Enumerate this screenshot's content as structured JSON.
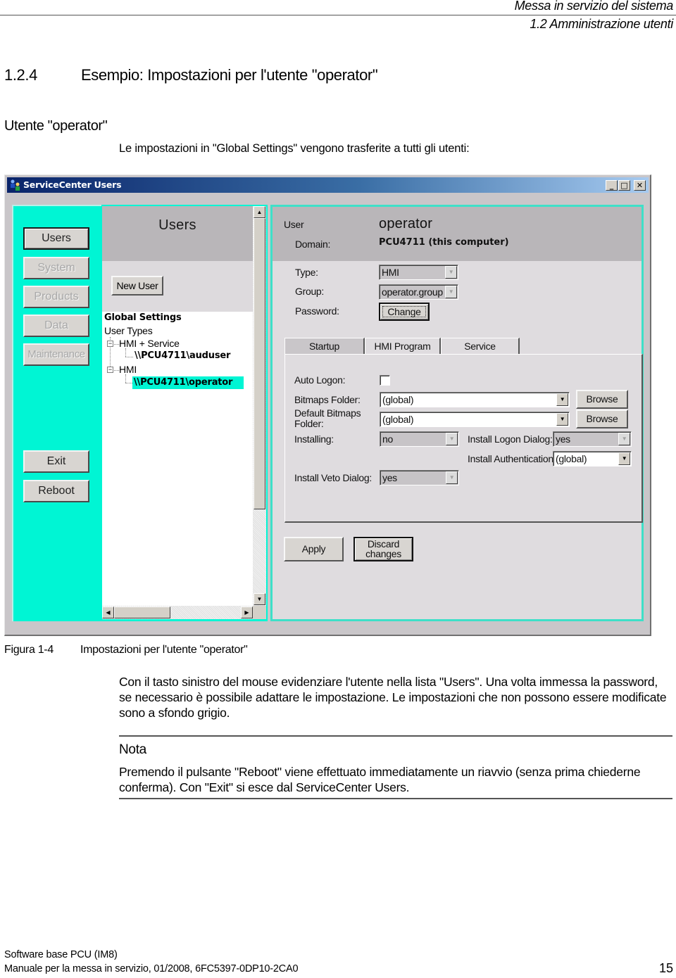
{
  "page_header": {
    "chapter": "Messa in servizio del sistema",
    "section": "1.2 Amministrazione utenti"
  },
  "heading": {
    "number": "1.2.4",
    "title": "Esempio: Impostazioni per l'utente \"operator\""
  },
  "subheading": "Utente \"operator\"",
  "intro_text": "Le impostazioni in \"Global Settings\" vengono trasferite a tutti gli utenti:",
  "window": {
    "title": "ServiceCenter Users",
    "controls": {
      "minimize": "_",
      "maximize": "□",
      "close": "✕"
    },
    "nav": {
      "items": [
        {
          "label": "Users",
          "state": "selected"
        },
        {
          "label": "System",
          "state": "disabled"
        },
        {
          "label": "Products",
          "state": "disabled"
        },
        {
          "label": "Data",
          "state": "disabled"
        },
        {
          "label": "Maintenance",
          "state": "disabled"
        }
      ],
      "exit_label": "Exit",
      "reboot_label": "Reboot"
    },
    "users_panel": {
      "title": "Users",
      "new_user_label": "New User",
      "tree": {
        "global_settings": "Global Settings",
        "user_types": "User Types",
        "groups": [
          {
            "label": "HMI + Service",
            "expander": "−",
            "users": [
              "\\\\PCU4711\\auduser"
            ]
          },
          {
            "label": "HMI",
            "expander": "−",
            "users": [
              "\\\\PCU4711\\operator"
            ]
          }
        ],
        "selected_user": "\\\\PCU4711\\operator"
      },
      "scroll_up": "▲",
      "scroll_down": "▼",
      "scroll_left": "◀",
      "scroll_right": "▶"
    },
    "details": {
      "user_label": "User",
      "user_value": "operator",
      "domain_label": "Domain:",
      "domain_value": "PCU4711 (this computer)",
      "type_label": "Type:",
      "type_value": "HMI",
      "group_label": "Group:",
      "group_value": "operator.group",
      "password_label": "Password:",
      "change_label": "Change",
      "tabs": [
        {
          "label": "Startup",
          "active": true
        },
        {
          "label": "HMI Program",
          "active": false
        },
        {
          "label": "Service",
          "active": false
        }
      ],
      "startup": {
        "auto_logon_label": "Auto Logon:",
        "auto_logon_checked": false,
        "bitmaps_folder_label": "Bitmaps Folder:",
        "bitmaps_folder_value": "(global)",
        "default_bitmaps_label_1": "Default Bitmaps",
        "default_bitmaps_label_2": "Folder:",
        "default_bitmaps_value": "(global)",
        "browse_label": "Browse",
        "installing_label": "Installing:",
        "installing_value": "no",
        "install_logon_label": "Install Logon Dialog:",
        "install_logon_value": "yes",
        "install_auth_label": "Install Authentication:",
        "install_auth_value": "(global)",
        "install_veto_label": "Install Veto Dialog:",
        "install_veto_value": "yes"
      },
      "apply_label": "Apply",
      "discard_label_1": "Discard",
      "discard_label_2": "changes"
    },
    "colors": {
      "accent_teal": "#00f5d4",
      "title_bar": "#0a246a",
      "panel_gray": "#b9b6b9"
    }
  },
  "figure": {
    "number": "Figura 1-4",
    "caption": "Impostazioni per l'utente \"operator\""
  },
  "body_paragraph": "Con il tasto sinistro del mouse evidenziare l'utente nella lista \"Users\". Una volta immessa la password, se necessario è possibile adattare le impostazione. Le impostazioni che non possono essere modificate sono a sfondo grigio.",
  "note": {
    "title": "Nota",
    "text": "Premendo il pulsante \"Reboot\" viene effettuato immediatamente un riavvio (senza prima chiederne conferma). Con \"Exit\" si esce dal ServiceCenter Users."
  },
  "footer": {
    "line1": "Software base PCU (IM8)",
    "line2": "Manuale per la messa in servizio, 01/2008, 6FC5397-0DP10-2CA0",
    "page_number": "15"
  },
  "icons": {
    "dropdown_arrow": "▼"
  }
}
